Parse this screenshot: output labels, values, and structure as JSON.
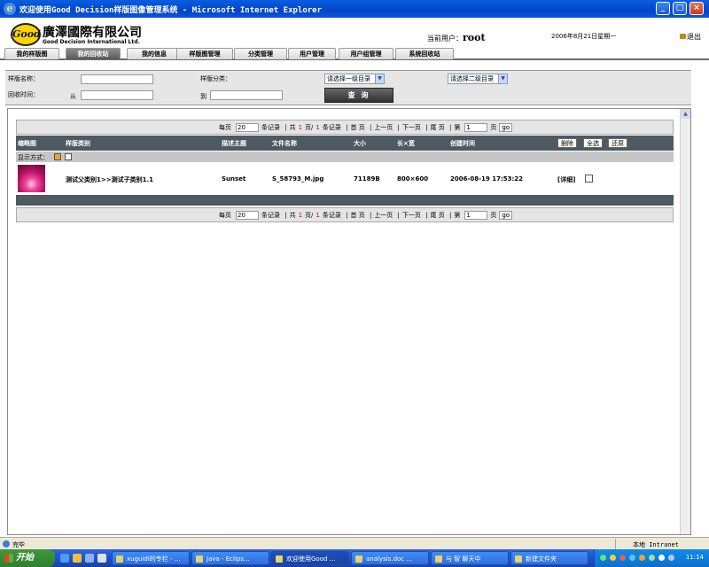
{
  "window": {
    "title": "欢迎使用Good Decision样版图像管理系统 - Microsoft Internet Explorer",
    "min_label": "_",
    "max_label": "□",
    "close_label": "×"
  },
  "header": {
    "logo_text": "Good",
    "company_cn": "廣澤國際有限公司",
    "company_en": "Good Decision International Ltd.",
    "current_user_label": "当前用户：",
    "current_user": "root",
    "date": "2006年8月21日星期一",
    "logout_label": "退出"
  },
  "nav": {
    "tabs": [
      {
        "label": "我的样版图"
      },
      {
        "label": "我的回收站"
      },
      {
        "label": "我的信息"
      },
      {
        "label": "样版图管理"
      },
      {
        "label": "分类管理"
      },
      {
        "label": "用户管理"
      },
      {
        "label": "用户组管理"
      },
      {
        "label": "系统回收站"
      }
    ],
    "active_index": 1
  },
  "search": {
    "name_label": "样版名称：",
    "category_label": "样版分类：",
    "category1_selected": "请选择一级目录",
    "category2_selected": "请选择二级目录",
    "recycle_time_label": "回收时间：",
    "from_label": "从",
    "to_label": "到",
    "query_button": "查 询"
  },
  "pager": {
    "per_page_prefix": "每页",
    "per_page_value": "20",
    "per_page_suffix": "条记录",
    "total_pages_prefix": "共",
    "total_pages": "1",
    "total_pages_mid": "页/",
    "total_records": "1",
    "total_records_suffix": "条记录",
    "first": "首 页",
    "prev": "上一页",
    "next": "下一页",
    "last": "尾 页",
    "goto_prefix": "第",
    "goto_value": "1",
    "goto_suffix": "页",
    "go_label": "go"
  },
  "table": {
    "headers": {
      "thumbnail": "缩略图",
      "category": "样版类别",
      "description": "描述主题",
      "filename": "文件名称",
      "size": "大小",
      "dimensions": "长×宽",
      "created": "创建时间"
    },
    "delete_button": "删除",
    "select_all_button": "全选",
    "restore_button": "还原",
    "display_mode_label": "显示方式：",
    "rows": [
      {
        "category": "测试父类别1>>测试子类别1.1",
        "description": "Sunset",
        "filename": "S_58793_M.jpg",
        "size": "71189B",
        "dimensions": "800×600",
        "created": "2006-08-19 17:53:22",
        "detail_link": "[详细]",
        "checked": false
      }
    ]
  },
  "statusbar": {
    "status": "完毕",
    "zone": "本地 Intranet"
  },
  "taskbar": {
    "start_label": "开始",
    "tasks": [
      {
        "label": "xuguidi的专栏 - ..."
      },
      {
        "label": "Java - Eclips..."
      },
      {
        "label": "欢迎使用Good ..."
      },
      {
        "label": "analysis.doc ..."
      },
      {
        "label": "与 智 聊天中"
      },
      {
        "label": "新建文件夹"
      }
    ],
    "active_task_index": 2,
    "clock": "11:14"
  }
}
